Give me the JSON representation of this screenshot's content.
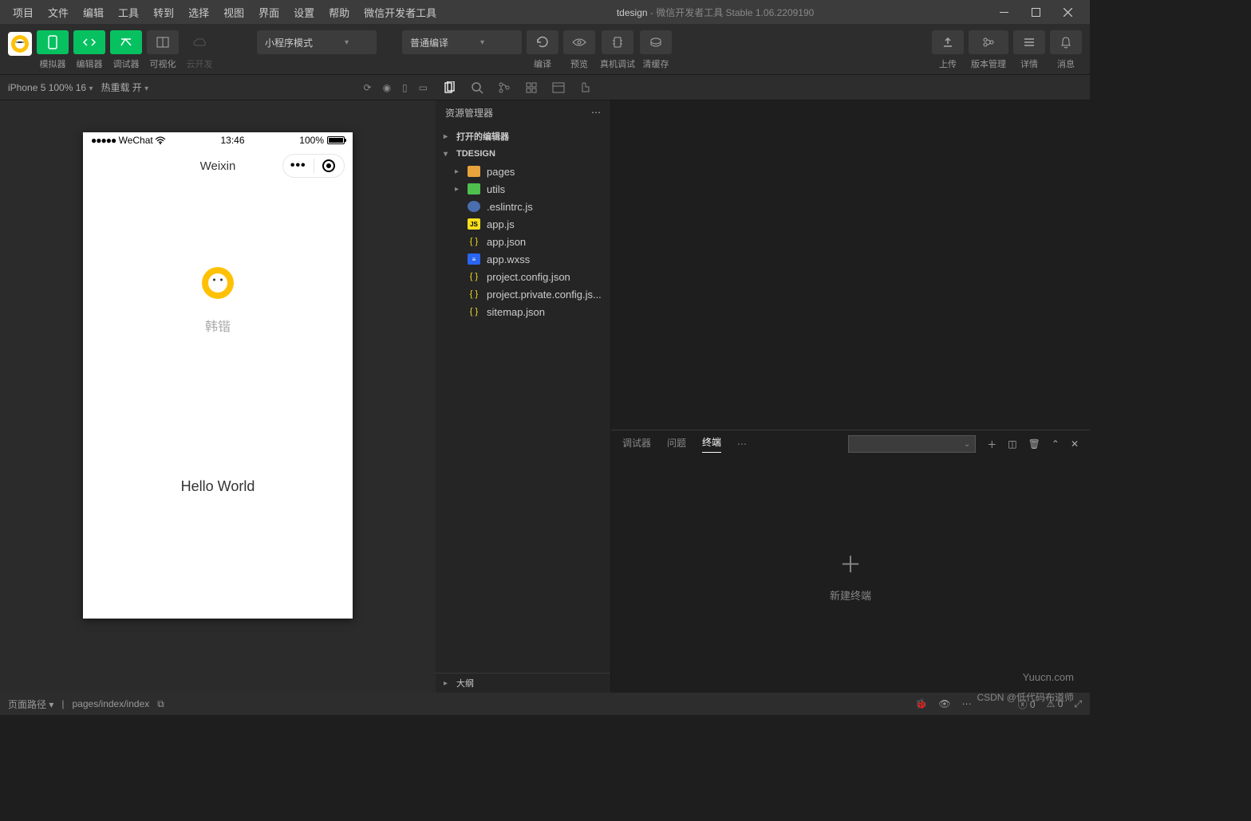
{
  "window": {
    "project": "tdesign",
    "title_suffix": " - 微信开发者工具 Stable 1.06.2209190"
  },
  "menu": [
    "项目",
    "文件",
    "编辑",
    "工具",
    "转到",
    "选择",
    "视图",
    "界面",
    "设置",
    "帮助",
    "微信开发者工具"
  ],
  "toolbar": {
    "simulator": "模拟器",
    "editor": "编辑器",
    "debugger": "调试器",
    "visualize": "可视化",
    "cloud": "云开发",
    "mode_select": "小程序模式",
    "compile_select": "普通编译",
    "compile": "编译",
    "preview": "预览",
    "real_debug": "真机调试",
    "clear_cache": "清缓存",
    "upload": "上传",
    "version": "版本管理",
    "detail": "详情",
    "messages": "消息"
  },
  "sim": {
    "device": "iPhone 5 100% 16",
    "hotreload": "热重载 开"
  },
  "phone": {
    "carrier": "WeChat",
    "time": "13:46",
    "battery": "100%",
    "nav_title": "Weixin",
    "avatar_name": "韩锴",
    "hello": "Hello World"
  },
  "explorer": {
    "title": "资源管理器",
    "open_editors": "打开的编辑器",
    "project": "TDESIGN",
    "outline": "大纲",
    "tree": [
      {
        "name": "pages",
        "type": "folder-orange",
        "indent": 1,
        "chev": "▸"
      },
      {
        "name": "utils",
        "type": "folder-green",
        "indent": 1,
        "chev": "▸"
      },
      {
        "name": ".eslintrc.js",
        "type": "cfg",
        "indent": 1
      },
      {
        "name": "app.js",
        "type": "js",
        "indent": 1
      },
      {
        "name": "app.json",
        "type": "json",
        "indent": 1
      },
      {
        "name": "app.wxss",
        "type": "css",
        "indent": 1
      },
      {
        "name": "project.config.json",
        "type": "json",
        "indent": 1
      },
      {
        "name": "project.private.config.js...",
        "type": "json",
        "indent": 1
      },
      {
        "name": "sitemap.json",
        "type": "json",
        "indent": 1
      }
    ]
  },
  "panel": {
    "tabs": [
      "调试器",
      "问题",
      "终端"
    ],
    "active": "终端",
    "new_terminal": "新建终端"
  },
  "statusbar": {
    "path_label": "页面路径",
    "path": "pages/index/index",
    "errors": "0",
    "warnings": "0"
  },
  "watermark": {
    "site": "Yuucn.com",
    "csdn": "CSDN @低代码布道师"
  }
}
